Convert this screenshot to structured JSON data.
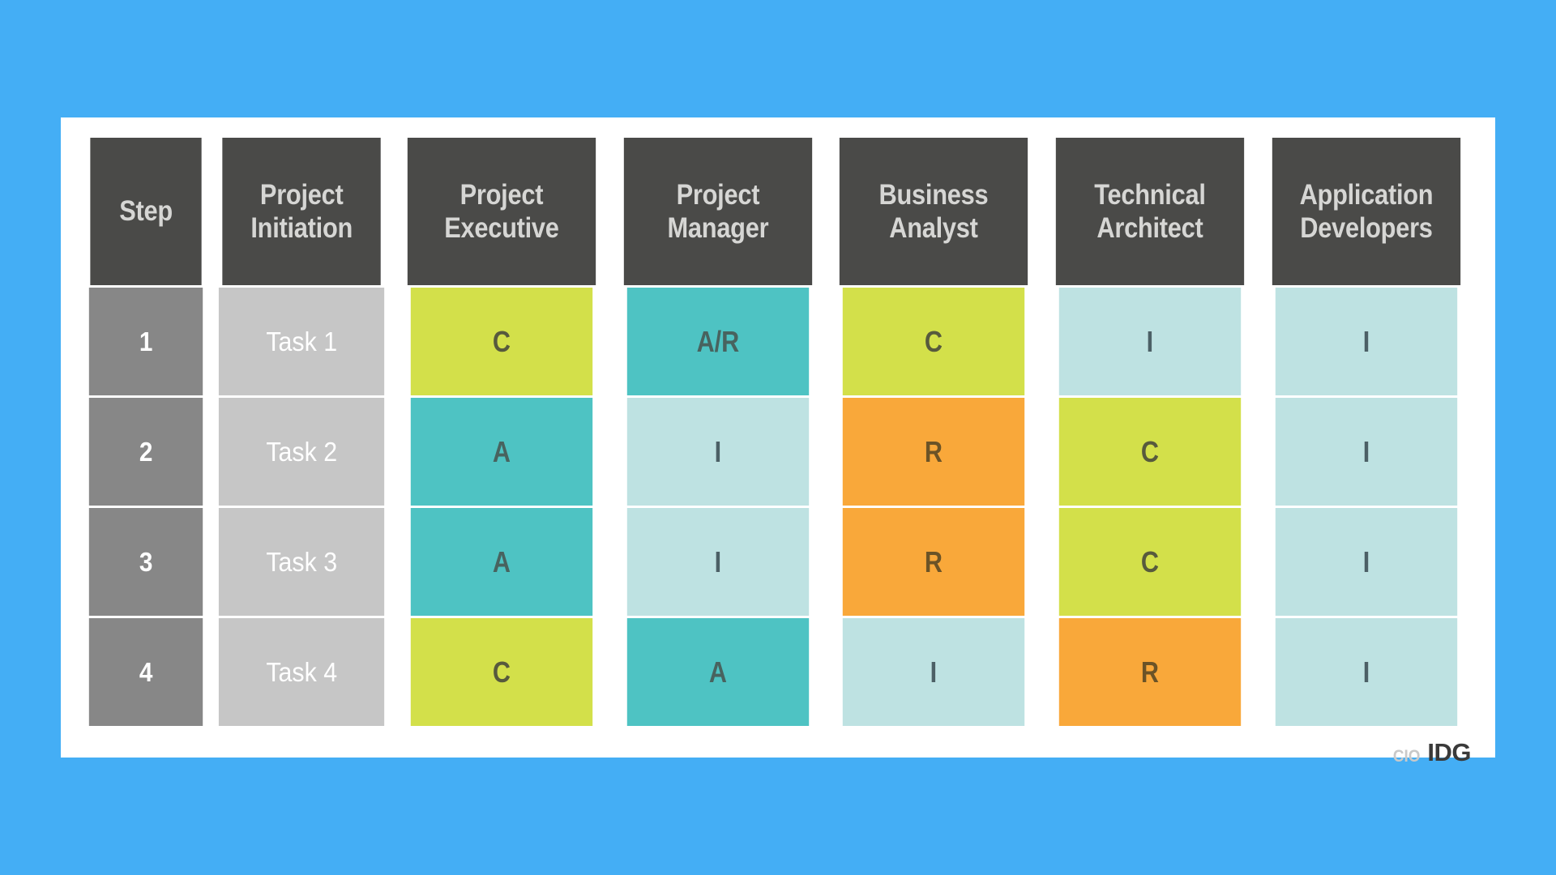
{
  "theme": {
    "page_background": "#44aef5",
    "card_background": "#ffffff",
    "header_background": "#4a4a48",
    "header_text": "#d6d6d4",
    "step_background": "#878787",
    "task_background": "#c6c6c6",
    "color_C": "#d3e04a",
    "color_A": "#4ec3c3",
    "color_I": "#bee2e2",
    "color_R": "#f9a83a"
  },
  "table": {
    "columns": [
      {
        "key": "step",
        "label": "Step"
      },
      {
        "key": "task",
        "label": "Project\nInitiation",
        "line1": "Project",
        "line2": "Initiation"
      },
      {
        "key": "project_executive",
        "line1": "Project",
        "line2": "Executive"
      },
      {
        "key": "project_manager",
        "line1": "Project",
        "line2": "Manager"
      },
      {
        "key": "business_analyst",
        "line1": "Business",
        "line2": "Analyst"
      },
      {
        "key": "technical_architect",
        "line1": "Technical",
        "line2": "Architect"
      },
      {
        "key": "application_developers",
        "line1": "Application",
        "line2": "Developers"
      }
    ],
    "rows": [
      {
        "step": "1",
        "task": "Task 1",
        "project_executive": "C",
        "project_manager": "A/R",
        "business_analyst": "C",
        "technical_architect": "I",
        "application_developers": "I"
      },
      {
        "step": "2",
        "task": "Task 2",
        "project_executive": "A",
        "project_manager": "I",
        "business_analyst": "R",
        "technical_architect": "C",
        "application_developers": "I"
      },
      {
        "step": "3",
        "task": "Task 3",
        "project_executive": "A",
        "project_manager": "I",
        "business_analyst": "R",
        "technical_architect": "C",
        "application_developers": "I"
      },
      {
        "step": "4",
        "task": "Task 4",
        "project_executive": "C",
        "project_manager": "A",
        "business_analyst": "I",
        "technical_architect": "R",
        "application_developers": "I"
      }
    ]
  },
  "footer": {
    "cio_label": "CIO",
    "idg_label": "IDG"
  }
}
